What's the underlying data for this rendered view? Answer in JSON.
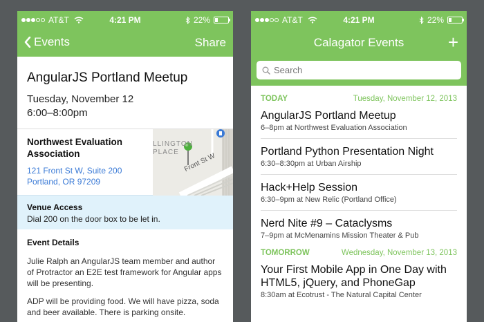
{
  "status": {
    "carrier": "AT&T",
    "time": "4:21 PM",
    "battery": "22%",
    "battery_level": 0.22
  },
  "detail": {
    "nav": {
      "back_label": "Events",
      "share_label": "Share"
    },
    "title": "AngularJS Portland Meetup",
    "date": "Tuesday, November 12",
    "time": "6:00–8:00pm",
    "venue": {
      "name": "Northwest Evaluation Association",
      "address_line1": "121 Front St W, Suite 200",
      "address_line2": "Portland, OR 97209"
    },
    "map": {
      "label_top": "LLINGTON",
      "label_mid": "PLACE",
      "street": "Front St W"
    },
    "access": {
      "title": "Venue Access",
      "text": "Dial 200 on the door box to be let in."
    },
    "details": {
      "title": "Event Details",
      "paragraphs": [
        "Julie Ralph an AngularJS team member and author of Protractor an E2E test framework for Angular apps will be presenting.",
        "ADP will be providing food. We will have pizza, soda and beer available. There is parking onsite."
      ]
    }
  },
  "list": {
    "nav": {
      "title": "Calagator Events",
      "add_label": "+"
    },
    "search": {
      "placeholder": "Search"
    },
    "sections": [
      {
        "label": "TODAY",
        "date": "Tuesday, November 12, 2013",
        "events": [
          {
            "name": "AngularJS Portland Meetup",
            "sub": "6–8pm at Northwest Evaluation Association"
          },
          {
            "name": "Portland Python Presentation Night",
            "sub": "6:30–8:30pm at Urban Airship"
          },
          {
            "name": "Hack+Help Session",
            "sub": "6:30–9pm at New Relic (Portland Office)"
          },
          {
            "name": "Nerd Nite #9 – Cataclysms",
            "sub": "7–9pm at McMenamins Mission Theater & Pub"
          }
        ]
      },
      {
        "label": "TOMORROW",
        "date": "Wednesday, November 13, 2013",
        "events": [
          {
            "name": "Your First Mobile App in One Day with HTML5, jQuery, and PhoneGap",
            "sub": "8:30am at Ecotrust - The Natural Capital Center"
          }
        ]
      }
    ]
  },
  "colors": {
    "accent": "#7ec45d",
    "link": "#3a7ad6",
    "background": "#565a5c",
    "access_bg": "#e0f2fb"
  }
}
